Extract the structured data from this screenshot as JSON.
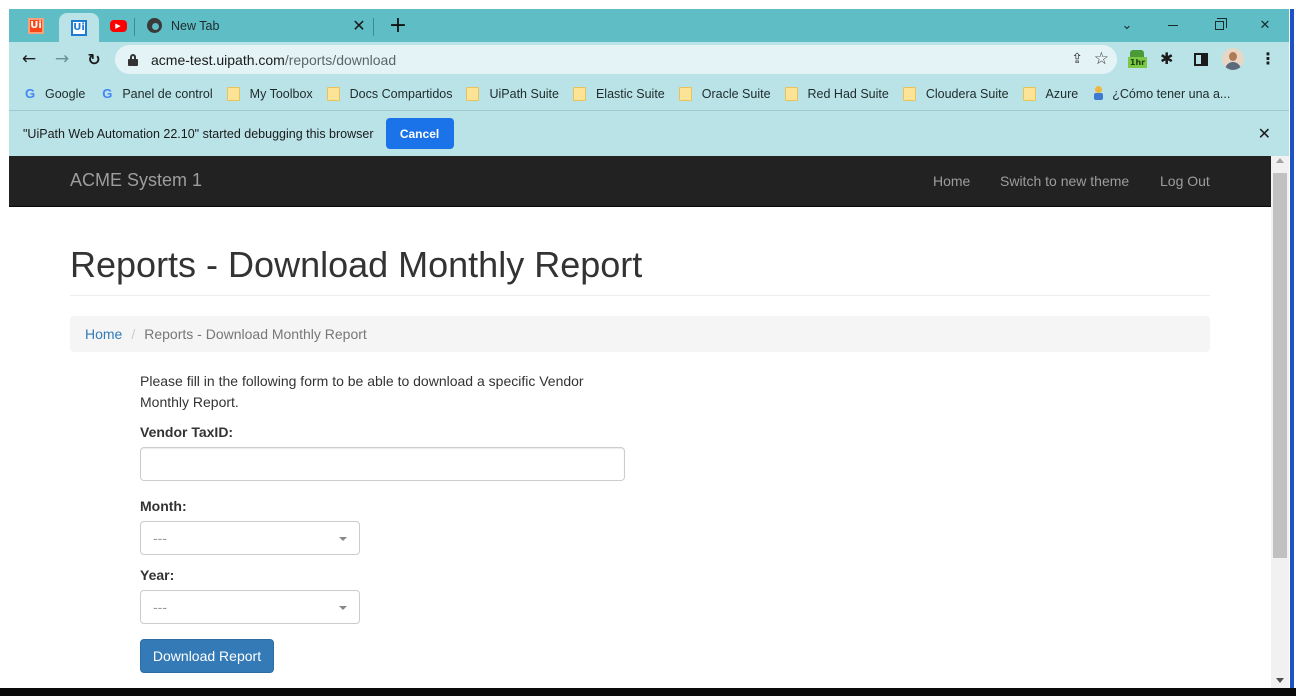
{
  "browser": {
    "tabs": [
      {
        "name": "UiPath Studio",
        "icon": "uipath-orange-icon",
        "pinned": true
      },
      {
        "name": "UiPath",
        "icon": "uipath-blue-icon",
        "pinned": true,
        "active": true
      },
      {
        "name": "YouTube",
        "icon": "youtube-icon",
        "pinned": true
      },
      {
        "title": "New Tab",
        "icon": "chrome-icon"
      }
    ],
    "new_tab_glyph": "+",
    "url_host": "acme-test.uipath.com",
    "url_path": "/reports/download",
    "extension_badge": "1hr",
    "bookmarks": [
      {
        "label": "Google",
        "icon": "google-icon"
      },
      {
        "label": "Panel de control",
        "icon": "google-icon"
      },
      {
        "label": "My Toolbox",
        "icon": "folder-icon"
      },
      {
        "label": "Docs Compartidos",
        "icon": "folder-icon"
      },
      {
        "label": "UiPath Suite",
        "icon": "folder-icon"
      },
      {
        "label": "Elastic Suite",
        "icon": "folder-icon"
      },
      {
        "label": "Oracle Suite",
        "icon": "folder-icon"
      },
      {
        "label": "Red Had Suite",
        "icon": "folder-icon"
      },
      {
        "label": "Cloudera Suite",
        "icon": "folder-icon"
      },
      {
        "label": "Azure",
        "icon": "folder-icon"
      },
      {
        "label": "¿Cómo tener una a...",
        "icon": "tip-icon"
      }
    ],
    "infobar": {
      "message": "\"UiPath Web Automation 22.10\" started debugging this browser",
      "cancel_label": "Cancel"
    },
    "colors": {
      "tabstrip": "#5fbdc5",
      "toolbar": "#b9e3e7",
      "accent": "#1a73e8"
    }
  },
  "app": {
    "brand": "ACME System 1",
    "nav": {
      "home": "Home",
      "theme": "Switch to new theme",
      "logout": "Log Out"
    },
    "page_title": "Reports - Download Monthly Report",
    "breadcrumb": {
      "home": "Home",
      "separator": "/",
      "current": "Reports - Download Monthly Report"
    },
    "form": {
      "intro": "Please fill in the following form to be able to download a specific Vendor Monthly Report.",
      "taxid_label": "Vendor TaxID:",
      "taxid_value": "",
      "month_label": "Month:",
      "month_value": "---",
      "year_label": "Year:",
      "year_value": "---",
      "submit_label": "Download Report"
    },
    "colors": {
      "navbar": "#222222",
      "link": "#337ab7",
      "button": "#337ab7"
    }
  }
}
